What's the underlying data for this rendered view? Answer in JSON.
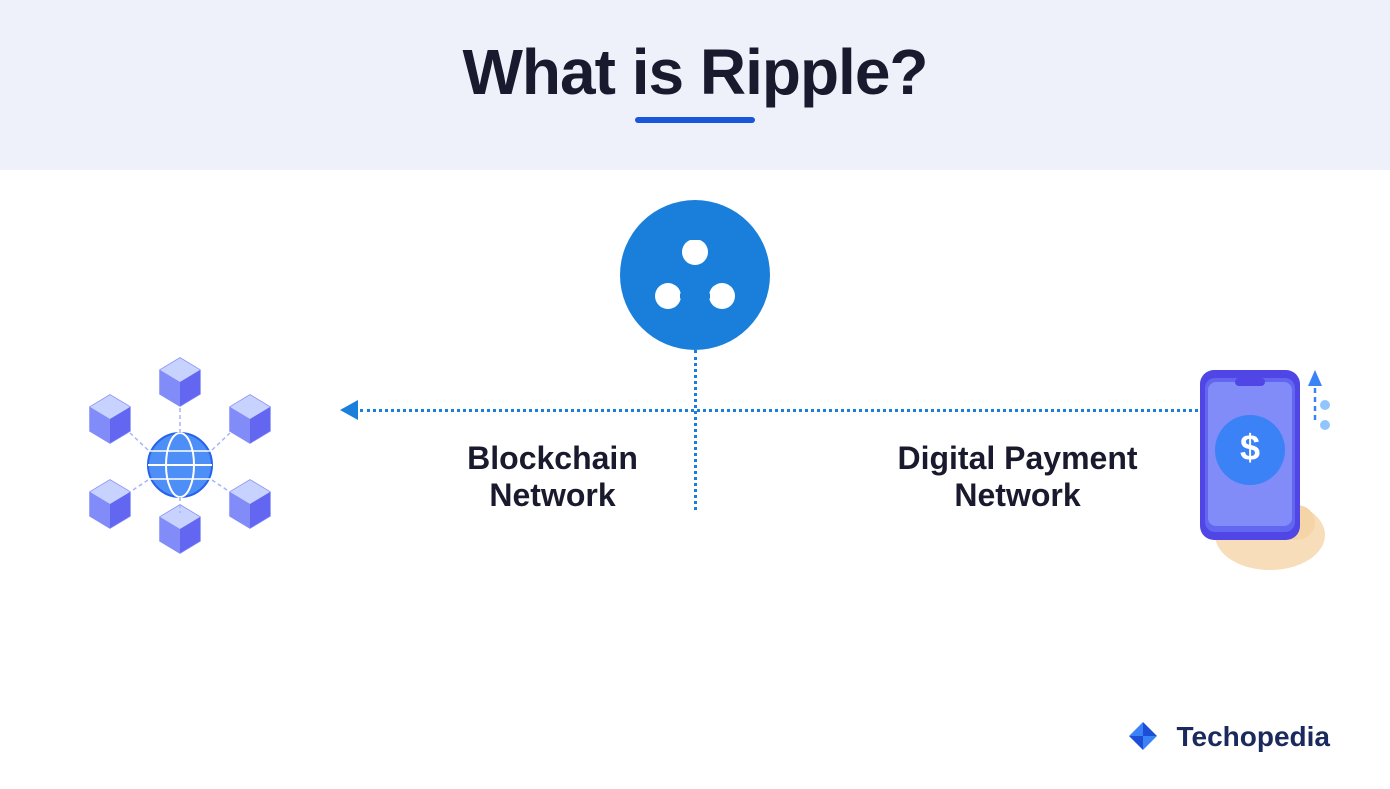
{
  "header": {
    "title": "What is Ripple?",
    "underline_color": "#1a56db",
    "background_color": "#eef1fa"
  },
  "content": {
    "left_label_line1": "Blockchain",
    "left_label_line2": "Network",
    "right_label_line1": "Digital Payment",
    "right_label_line2": "Network",
    "arrow_color": "#1a7fdb",
    "ripple_bg_color": "#1a7fdb"
  },
  "brand": {
    "name": "Techopedia",
    "color": "#1a2a5e"
  }
}
